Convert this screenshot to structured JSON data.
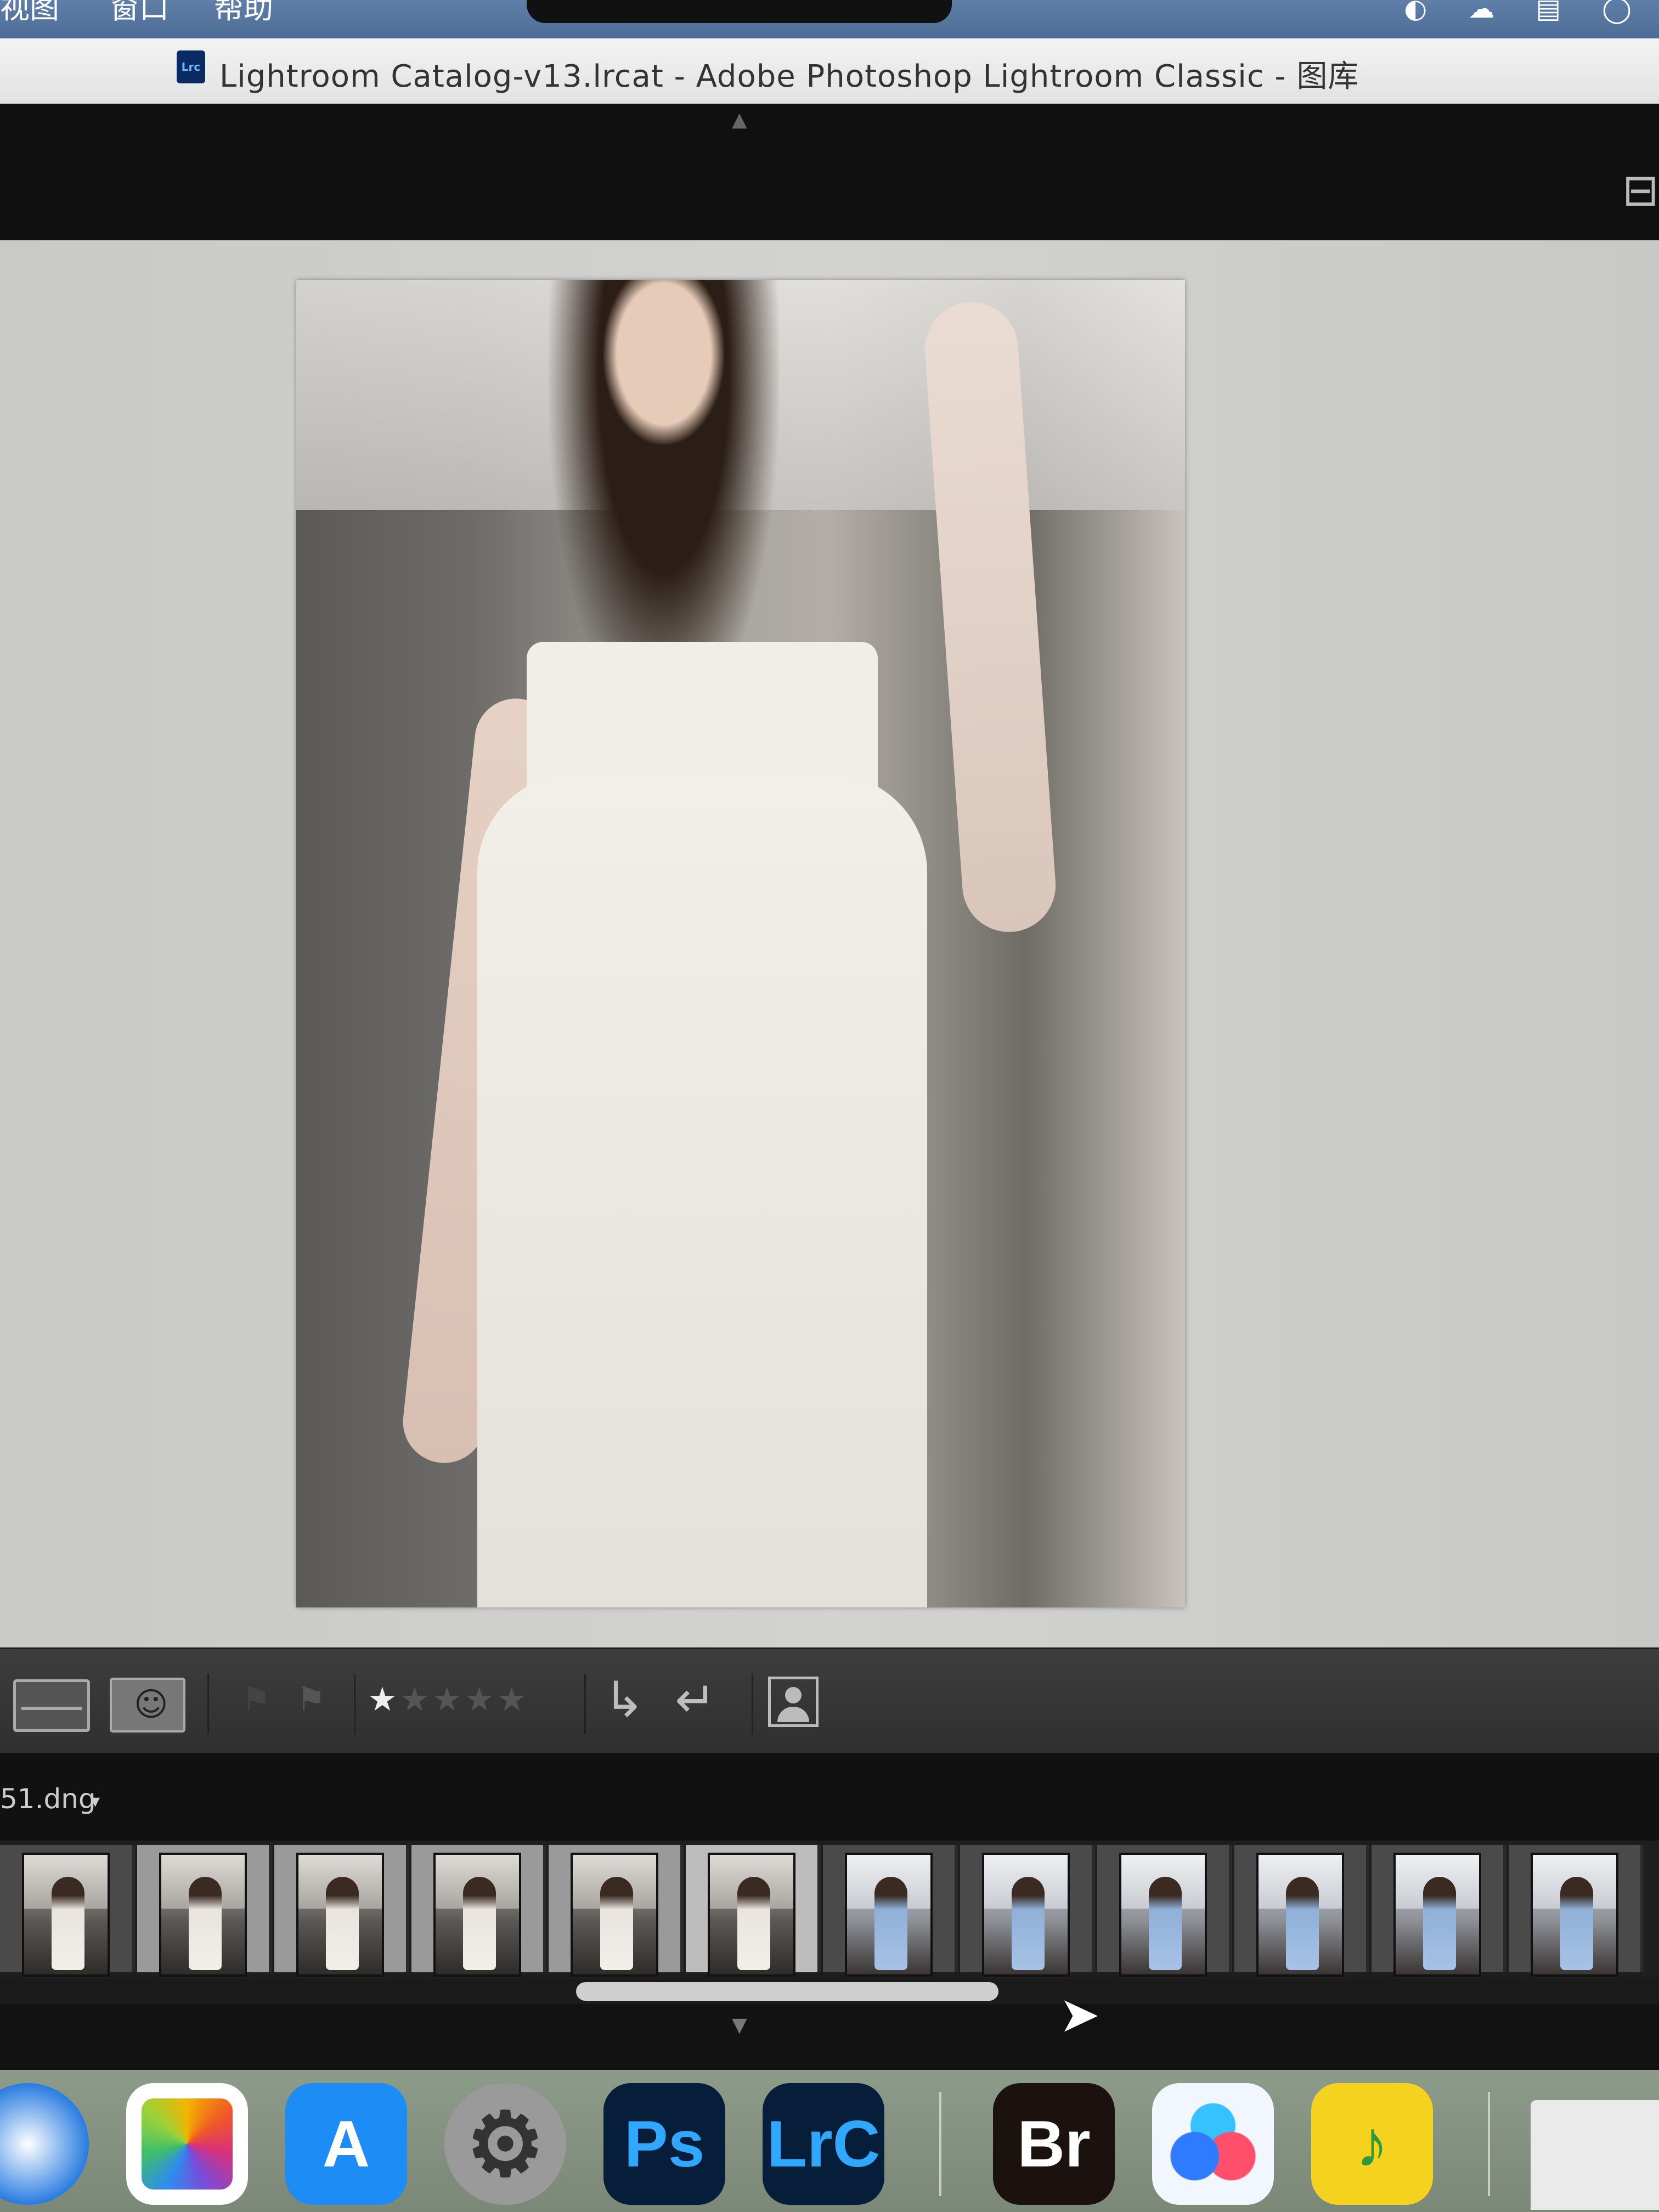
{
  "menubar": {
    "items": [
      "视图",
      "窗口",
      "帮助"
    ],
    "wifi_glyph": "◦"
  },
  "window": {
    "doc_icon_label": "Lrc",
    "title": "Lightroom Catalog-v13.lrcat - Adobe Photoshop Lightroom Classic - 图库"
  },
  "panels": {
    "top_collapse_glyph": "▲",
    "bottom_collapse_glyph": "▼"
  },
  "toolbar": {
    "rating": 1,
    "rating_max": 5,
    "star_filled": "★",
    "star_empty": "★",
    "flag_pick_glyph": "⚑",
    "flag_reject_glyph": "⚑",
    "rotate_left_glyph": "↳",
    "rotate_right_glyph": "↵",
    "people_glyph": "☺"
  },
  "filmstrip": {
    "current_file": "51.dng",
    "dropdown_glyph": "▾",
    "thumbnails": [
      {
        "tone": "dark",
        "scene": "beach-rocks"
      },
      {
        "tone": "light",
        "scene": "beach-rocks"
      },
      {
        "tone": "light",
        "scene": "beach-rocks"
      },
      {
        "tone": "light",
        "scene": "beach-rocks"
      },
      {
        "tone": "light",
        "scene": "beach-rocks"
      },
      {
        "tone": "selected",
        "scene": "beach-rocks"
      },
      {
        "tone": "dark",
        "scene": "sea-blue"
      },
      {
        "tone": "dark",
        "scene": "sea-blue"
      },
      {
        "tone": "dark",
        "scene": "sea-blue"
      },
      {
        "tone": "dark",
        "scene": "sea-blue"
      },
      {
        "tone": "dark",
        "scene": "sea-blue"
      },
      {
        "tone": "dark",
        "scene": "sea-blue"
      }
    ]
  },
  "dock": {
    "apps": [
      {
        "name": "safari-icon",
        "label": "",
        "bg": "#2a7de1",
        "fg": "#ffffff"
      },
      {
        "name": "photos-icon",
        "label": "",
        "bg": "#ffffff",
        "fg": "#e05a3a"
      },
      {
        "name": "app-store-icon",
        "label": "A",
        "bg": "#1d8cf5",
        "fg": "#ffffff"
      },
      {
        "name": "system-settings-icon",
        "label": "⚙",
        "bg": "#9a9a9a",
        "fg": "#333333"
      },
      {
        "name": "photoshop-icon",
        "label": "Ps",
        "bg": "#061e3a",
        "fg": "#31a8ff"
      },
      {
        "name": "lightroom-classic-icon",
        "label": "LrC",
        "bg": "#061e3a",
        "fg": "#31a8ff"
      },
      {
        "name": "bridge-icon",
        "label": "Br",
        "bg": "#1b1210",
        "fg": "#ffffff"
      },
      {
        "name": "baidu-netdisk-icon",
        "label": "",
        "bg": "#f2f6ff",
        "fg": "#2f7bff"
      },
      {
        "name": "qq-music-icon",
        "label": "♪",
        "bg": "#f5d21e",
        "fg": "#2a9b3f"
      }
    ]
  }
}
